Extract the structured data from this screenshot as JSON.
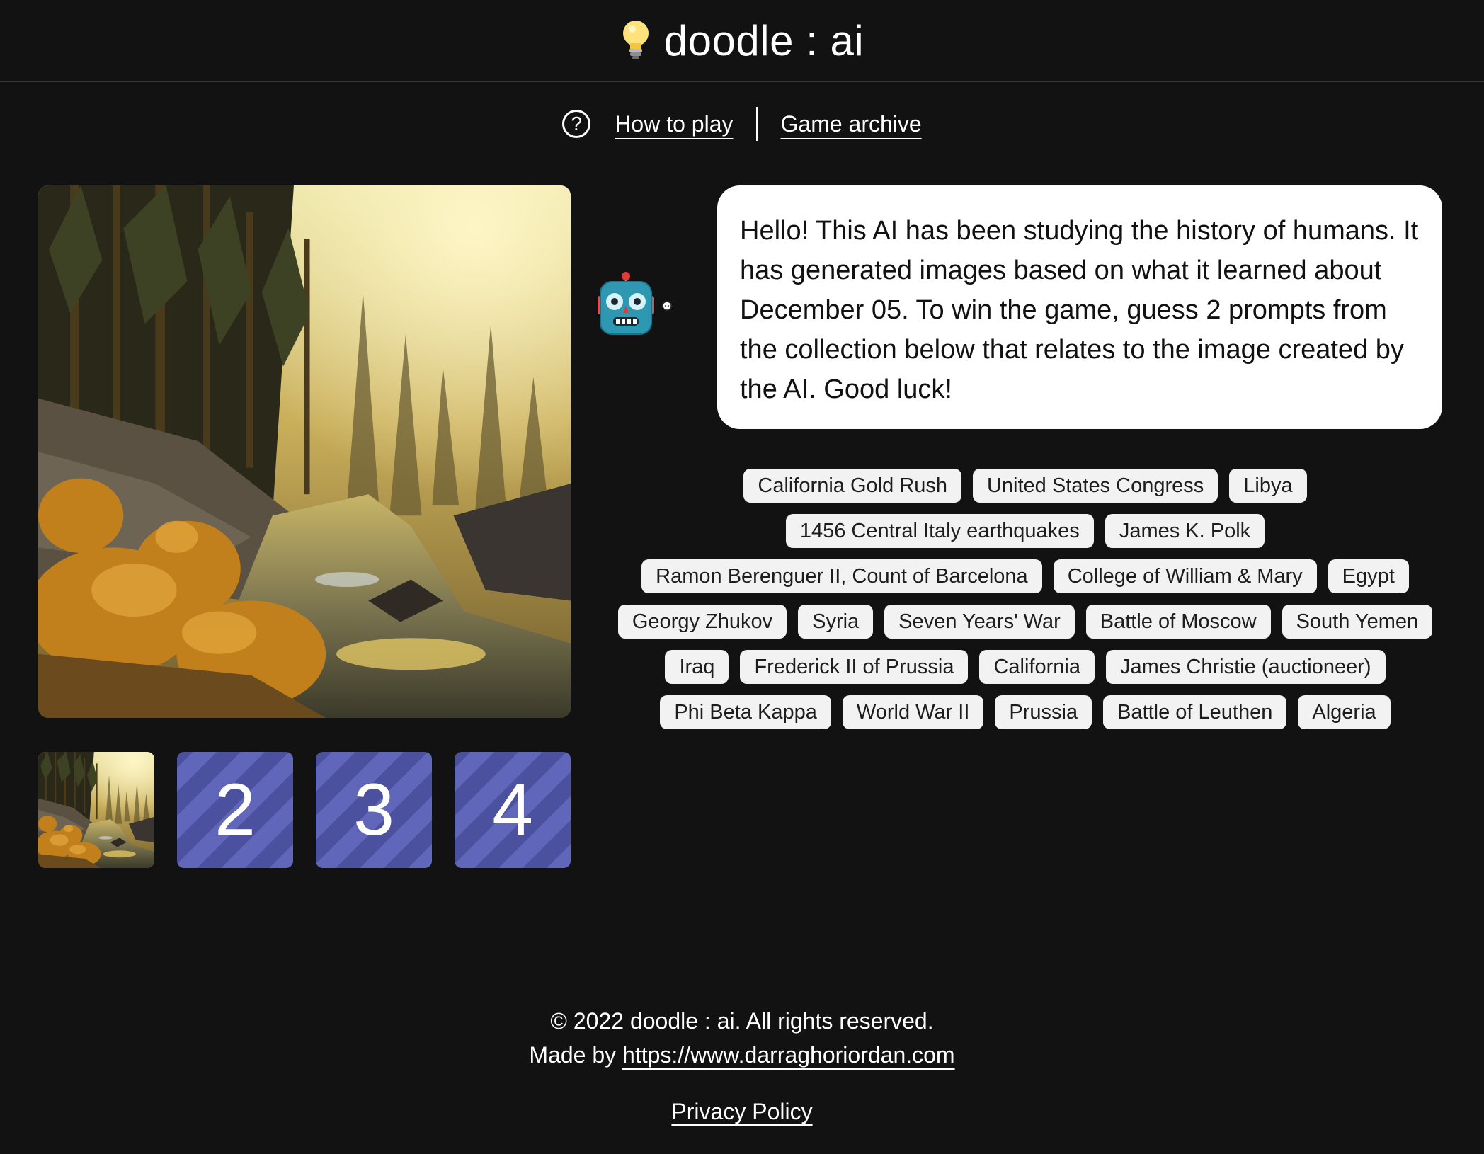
{
  "header": {
    "title": "doodle : ai",
    "icon": "lightbulb-icon"
  },
  "nav": {
    "help_icon": "question-circle-icon",
    "how_to_play": "How to play",
    "game_archive": "Game archive"
  },
  "thumbnails": [
    "2",
    "3",
    "4"
  ],
  "robot_icon": "robot-icon",
  "message": "Hello! This AI has been studying the history of humans. It has generated images based on what it learned about December 05. To win the game, guess 2 prompts from the collection below that relates to the image created by the AI. Good luck!",
  "tags": [
    "California Gold Rush",
    "United States Congress",
    "Libya",
    "1456 Central Italy earthquakes",
    "James K. Polk",
    "Ramon Berenguer II, Count of Barcelona",
    "College of William & Mary",
    "Egypt",
    "Georgy Zhukov",
    "Syria",
    "Seven Years' War",
    "Battle of Moscow",
    "South Yemen",
    "Iraq",
    "Frederick II of Prussia",
    "California",
    "James Christie (auctioneer)",
    "Phi Beta Kappa",
    "World War II",
    "Prussia",
    "Battle of Leuthen",
    "Algeria"
  ],
  "footer": {
    "copyright": "© 2022 doodle : ai. All rights reserved.",
    "made_by_prefix": "Made by ",
    "made_by_link": "https://www.darraghoriordan.com",
    "privacy": "Privacy Policy"
  },
  "colors": {
    "background": "#121212",
    "locked_tile_a": "#6067bb",
    "locked_tile_b": "#4b519e",
    "tag_bg": "#f2f2f2"
  }
}
